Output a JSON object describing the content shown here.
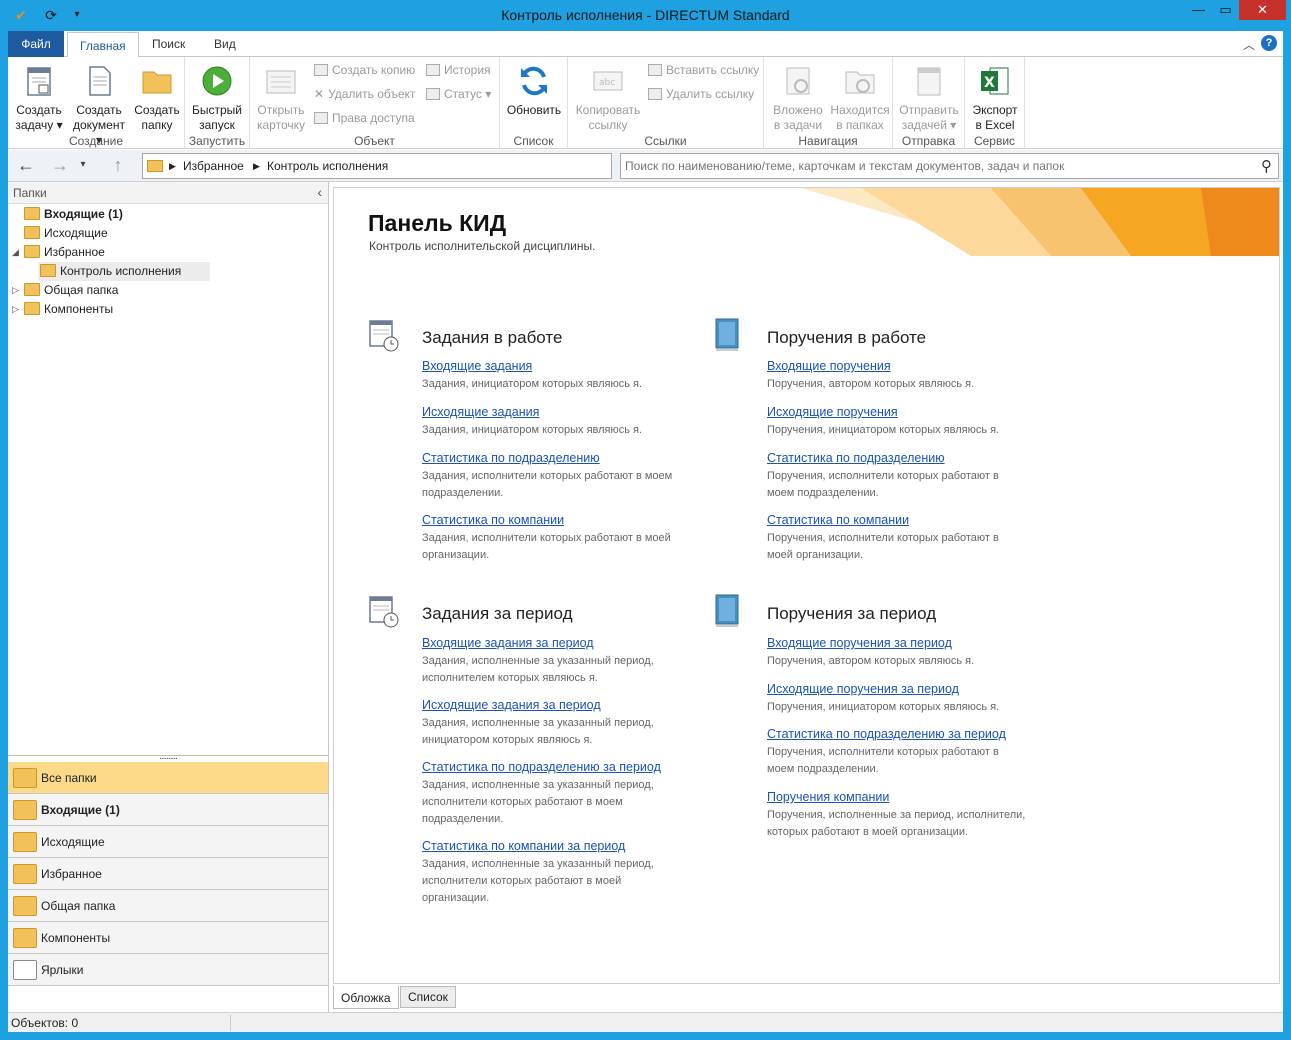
{
  "window": {
    "title": "Контроль исполнения - DIRECTUM Standard"
  },
  "ribbon_tabs": [
    "Файл",
    "Главная",
    "Поиск",
    "Вид"
  ],
  "ribbon": {
    "create": {
      "task": [
        "Создать",
        "задачу"
      ],
      "doc": [
        "Создать",
        "документ"
      ],
      "folder": [
        "Создать",
        "папку"
      ],
      "group": "Создание"
    },
    "launch": {
      "quick": [
        "Быстрый",
        "запуск"
      ],
      "group": "Запустить"
    },
    "object": {
      "open": [
        "Открыть",
        "карточку"
      ],
      "copy": "Создать копию",
      "delete": "Удалить объект",
      "rights": "Права доступа",
      "history": "История",
      "status": "Статус",
      "group": "Объект"
    },
    "list": {
      "refresh": "Обновить",
      "group": "Список"
    },
    "links": {
      "copy": [
        "Копировать",
        "ссылку"
      ],
      "paste": "Вставить ссылку",
      "delete": "Удалить ссылку",
      "group": "Ссылки"
    },
    "navigation": {
      "in_tasks": [
        "Вложено",
        "в задачи"
      ],
      "in_folders": [
        "Находится",
        "в папках"
      ],
      "group": "Навигация"
    },
    "send": {
      "send_tasks": [
        "Отправить",
        "задачей"
      ],
      "group": "Отправка"
    },
    "service": {
      "excel": [
        "Экспорт",
        "в Excel"
      ],
      "group": "Сервис"
    }
  },
  "address": {
    "crumbs": [
      "Избранное",
      "Контроль исполнения"
    ]
  },
  "search": {
    "placeholder": "Поиск по наименованию/теме, карточкам и текстам документов, задач и папок"
  },
  "left": {
    "header": "Папки",
    "tree": [
      "Входящие (1)",
      "Исходящие",
      "Избранное",
      "Контроль исполнения",
      "Общая папка",
      "Компоненты"
    ],
    "nav": [
      "Все папки",
      "Входящие (1)",
      "Исходящие",
      "Избранное",
      "Общая папка",
      "Компоненты",
      "Ярлыки"
    ]
  },
  "panel": {
    "title": "Панель КИД",
    "subtitle": "Контроль исполнительской дисциплины.",
    "s1": {
      "title": "Задания в работе",
      "items": [
        {
          "link": "Входящие задания",
          "desc": "Задания, инициатором которых являюсь я."
        },
        {
          "link": "Исходящие задания",
          "desc": "Задания, инициатором которых являюсь я."
        },
        {
          "link": "Статистика по подразделению",
          "desc": "Задания, исполнители которых работают в моем подразделении."
        },
        {
          "link": "Статистика по компании",
          "desc": "Задания, исполнители которых работают в моей организации."
        }
      ]
    },
    "s2": {
      "title": "Поручения в работе",
      "items": [
        {
          "link": "Входящие поручения",
          "desc": "Поручения, автором которых являюсь я."
        },
        {
          "link": "Исходящие поручения",
          "desc": "Поручения, инициатором которых являюсь я."
        },
        {
          "link": "Статистика по подразделению",
          "desc": "Поручения, исполнители которых работают в моем подразделении."
        },
        {
          "link": "Статистика по компании",
          "desc": "Поручения, исполнители которых работают в моей организации."
        }
      ]
    },
    "s3": {
      "title": "Задания за период",
      "items": [
        {
          "link": "Входящие задания за период",
          "desc": "Задания, исполненные за указанный период, исполнителем которых являюсь я."
        },
        {
          "link": "Исходящие задания за период",
          "desc": "Задания, исполненные за указанный период, инициатором которых являюсь я."
        },
        {
          "link": "Статистика по подразделению за период",
          "desc": "Задания, исполненные за указанный период, исполнители которых работают в моем подразделении."
        },
        {
          "link": "Статистика по компании за период",
          "desc": "Задания, исполненные за указанный период, исполнители которых работают в моей организации."
        }
      ]
    },
    "s4": {
      "title": "Поручения за период",
      "items": [
        {
          "link": "Входящие поручения за период",
          "desc": "Поручения, автором которых являюсь я."
        },
        {
          "link": "Исходящие поручения за период",
          "desc": "Поручения, инициатором которых являюсь я."
        },
        {
          "link": "Статистика по подразделению за период",
          "desc": "Поручения, исполнители которых работают в моем подразделении."
        },
        {
          "link": "Поручения компании",
          "desc": "Поручения, исполненные за период, исполнители, которых работают в моей организации."
        }
      ]
    }
  },
  "bottom_tabs": [
    "Обложка",
    "Список"
  ],
  "status": {
    "objects": "Объектов: 0"
  },
  "colors": {
    "accent": "#1fa0e0",
    "file_tab": "#1e5a9e",
    "link": "#1a52b5",
    "selected_nav": "#fdd98a",
    "banner": "#f5a623"
  }
}
